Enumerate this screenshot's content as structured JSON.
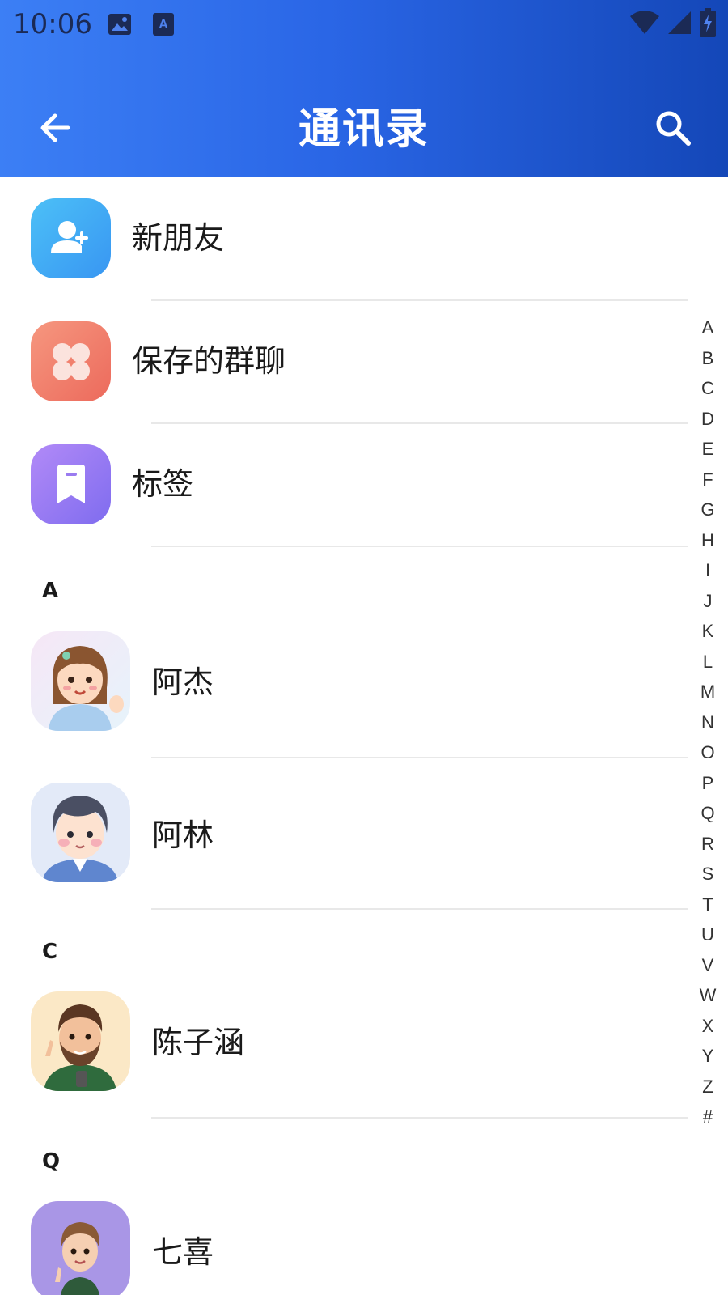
{
  "status_bar": {
    "time": "10:06",
    "left_icons": [
      "image-icon",
      "keyboard-a-icon"
    ],
    "right_icons": [
      "wifi-icon",
      "signal-icon",
      "battery-charging-icon"
    ]
  },
  "app_bar": {
    "title": "通讯录",
    "back_icon": "arrow-left-icon",
    "search_icon": "search-icon",
    "gradient": [
      "#3c7ff5",
      "#1447b8"
    ]
  },
  "functions": [
    {
      "label": "新朋友",
      "icon": "add-person-icon",
      "color": "#3aaaf5"
    },
    {
      "label": "保存的群聊",
      "icon": "group-chat-icon",
      "color": "#f07f6a"
    },
    {
      "label": "标签",
      "icon": "tag-icon",
      "color": "#9a7bf0"
    }
  ],
  "sections": [
    {
      "letter": "A",
      "contacts": [
        {
          "name": "阿杰",
          "avatar": "girl-avatar"
        },
        {
          "name": "阿林",
          "avatar": "boy-avatar"
        }
      ]
    },
    {
      "letter": "C",
      "contacts": [
        {
          "name": "陈子涵",
          "avatar": "bearded-man-avatar"
        }
      ]
    },
    {
      "letter": "Q",
      "contacts": [
        {
          "name": "七喜",
          "avatar": "boy-purple-avatar"
        }
      ]
    }
  ],
  "alpha_index": [
    "A",
    "B",
    "C",
    "D",
    "E",
    "F",
    "G",
    "H",
    "I",
    "J",
    "K",
    "L",
    "M",
    "N",
    "O",
    "P",
    "Q",
    "R",
    "S",
    "T",
    "U",
    "V",
    "W",
    "X",
    "Y",
    "Z",
    "#"
  ]
}
